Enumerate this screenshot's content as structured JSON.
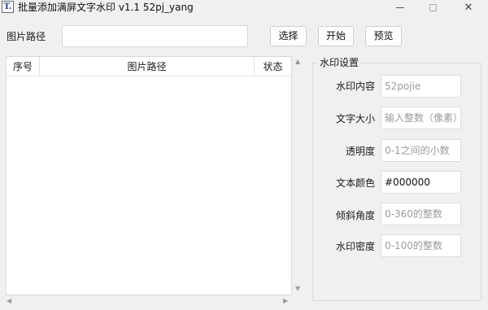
{
  "window": {
    "icon_text": "T.",
    "title": "批量添加满屏文字水印 v1.1   52pj_yang",
    "controls": {
      "minimize_icon": "minimize-icon",
      "maximize_icon": "maximize-icon",
      "close_icon": "close-icon",
      "close_glyph": "✕"
    }
  },
  "toolbar": {
    "path_label": "图片路径",
    "path_value": "",
    "select_label": "选择",
    "start_label": "开始",
    "preview_label": "预览"
  },
  "table": {
    "columns": [
      "序号",
      "图片路径",
      "状态"
    ],
    "rows": []
  },
  "scrollbars": {
    "up": "▲",
    "down": "▼",
    "left": "◀",
    "right": "▶"
  },
  "settings": {
    "title": "水印设置",
    "fields": [
      {
        "label": "水印内容",
        "value": "",
        "placeholder": "52pojie"
      },
      {
        "label": "文字大小",
        "value": "",
        "placeholder": "输入整数（像素）"
      },
      {
        "label": "透明度",
        "value": "",
        "placeholder": "0-1之间的小数"
      },
      {
        "label": "文本颜色",
        "value": "#000000",
        "placeholder": ""
      },
      {
        "label": "倾斜角度",
        "value": "",
        "placeholder": "0-360的整数"
      },
      {
        "label": "水印密度",
        "value": "",
        "placeholder": "0-100的整数"
      }
    ]
  },
  "colors": {
    "window_bg": "#f0f0f0",
    "input_bg": "#ffffff",
    "placeholder": "#9b9b9b",
    "text": "#111111"
  }
}
